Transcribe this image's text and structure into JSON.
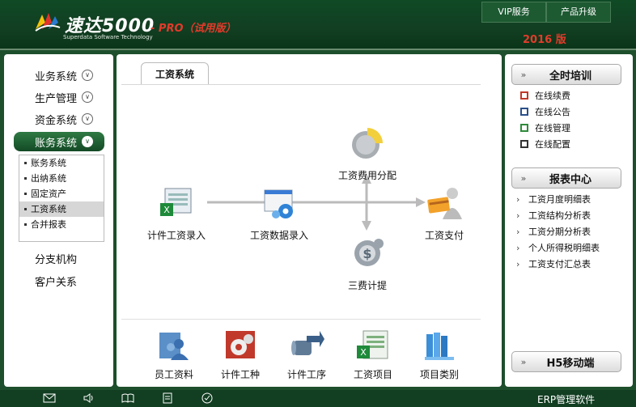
{
  "header": {
    "brand_name": "速达5000",
    "brand_sub": "Superdata Software Technology",
    "edition": "- PRO（试用版）",
    "nav": [
      "VIP服务",
      "产品升级"
    ],
    "year": "2016 版"
  },
  "sidebar": {
    "menus": [
      "业务系统",
      "生产管理",
      "资金系统",
      "账务系统"
    ],
    "active_menu": "账务系统",
    "submenu": [
      "账务系统",
      "出纳系统",
      "固定资产",
      "工资系统",
      "合并报表"
    ],
    "selected_submenu": "工资系统",
    "extra": [
      "分支机构",
      "客户关系"
    ]
  },
  "main": {
    "tab": "工资系统",
    "flow": {
      "piecework_entry": "计件工资录入",
      "salary_data_entry": "工资数据录入",
      "cost_allocation": "工资费用分配",
      "salary_payment": "工资支付",
      "three_fees": "三费计提"
    },
    "bottom": [
      "员工资料",
      "计件工种",
      "计件工序",
      "工资项目",
      "项目类别"
    ]
  },
  "right": {
    "training_title": "全时培训",
    "training_links": [
      "在线续费",
      "在线公告",
      "在线管理",
      "在线配置"
    ],
    "report_title": "报表中心",
    "report_links": [
      "工资月度明细表",
      "工资结构分析表",
      "工资分期分析表",
      "个人所得税明细表",
      "工资支付汇总表"
    ],
    "mobile_title": "H5移动端"
  },
  "footer": {
    "text": "ERP管理软件",
    "icons": [
      "mail-icon",
      "speaker-icon",
      "book-icon",
      "document-icon",
      "check-circle-icon"
    ]
  },
  "colors": {
    "brand_green": "#123e22",
    "accent_red": "#e33c2a",
    "active_menu": "#1d5a32"
  }
}
